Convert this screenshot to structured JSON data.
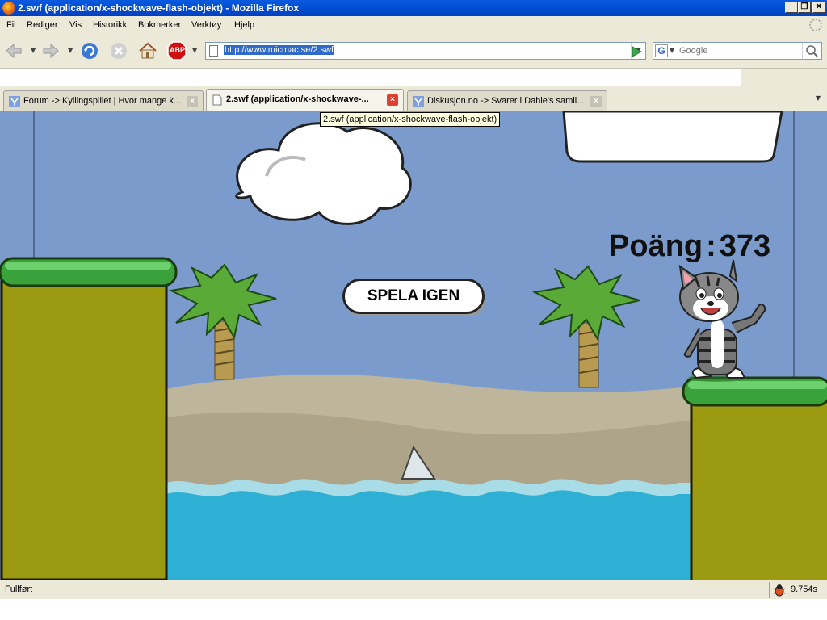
{
  "window": {
    "title": "2.swf (application/x-shockwave-flash-objekt) - Mozilla Firefox",
    "minimize": "_",
    "maximize": "❐",
    "close": "✕"
  },
  "menu": [
    "Fil",
    "Rediger",
    "Vis",
    "Historikk",
    "Bokmerker",
    "Verktøy",
    "Hjelp"
  ],
  "navigation": {
    "url": "http://www.micmac.se/2.swf",
    "search_placeholder": "Google",
    "buttons": [
      "back-icon",
      "forward-icon",
      "reload-icon",
      "stop-icon",
      "home-icon",
      "adblock-icon"
    ],
    "adblock_label": "ABP"
  },
  "tabs": [
    {
      "label": "Forum -> Kyllingspillet | Hvor mange k...",
      "active": false,
      "icon": "forum-favicon"
    },
    {
      "label": "2.swf (application/x-shockwave-...",
      "active": true,
      "icon": "page-icon"
    },
    {
      "label": "Diskusjon.no -> Svarer i Dahle's samli...",
      "active": false,
      "icon": "forum-favicon"
    }
  ],
  "tooltip": "2.swf (application/x-shockwave-flash-objekt)",
  "game": {
    "score_label": "Poäng",
    "score_sep": ":",
    "score_value": "373",
    "replay_button": "SPELA IGEN",
    "colors": {
      "sky": "#7b9bcd",
      "water": "#2eb0d4",
      "sand": "#bdb59c",
      "grass": "#3aa23a",
      "pillar": "#9c9a10"
    }
  },
  "status": {
    "text": "Fullført",
    "timer": "9.754s"
  }
}
